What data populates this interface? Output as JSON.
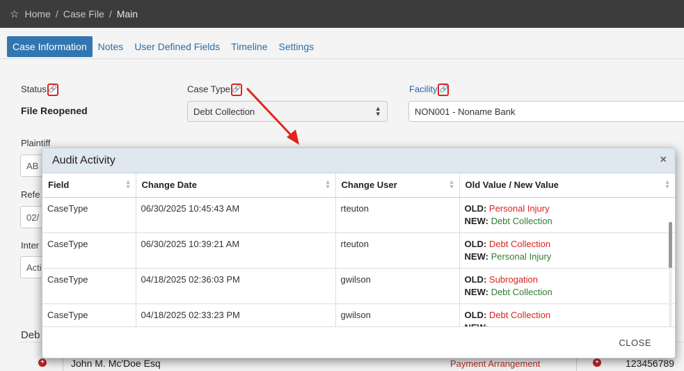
{
  "breadcrumb": {
    "items": [
      "Home",
      "Case File",
      "Main"
    ],
    "separator": "/"
  },
  "tabs": [
    "Case Information",
    "Notes",
    "User Defined Fields",
    "Timeline",
    "Settings"
  ],
  "form": {
    "status_label": "Status",
    "status_value": "File Reopened",
    "case_type_label": "Case Type",
    "case_type_value": "Debt Collection",
    "facility_label": "Facility",
    "facility_value": "NON001 - Noname Bank",
    "plaintiff_label": "Plaintiff",
    "plaintiff_value_partial": "AB",
    "reference_label_partial": "Refe",
    "reference_value_partial": "02/",
    "inter_label_partial": "Inter",
    "inter_value_partial": "Acti",
    "debtor_label_partial": "Deb"
  },
  "bottom_row": {
    "name": "John M. Mc'Doe Esq",
    "status": "Payment Arrangement",
    "number": "123456789"
  },
  "modal": {
    "title": "Audit Activity",
    "columns": [
      "Field",
      "Change Date",
      "Change User",
      "Old Value / New Value"
    ],
    "old_label": "OLD:",
    "new_label": "NEW:",
    "rows": [
      {
        "field": "CaseType",
        "date": "06/30/2025 10:45:43 AM",
        "user": "rteuton",
        "old": "Personal Injury",
        "new": "Debt Collection"
      },
      {
        "field": "CaseType",
        "date": "06/30/2025 10:39:21 AM",
        "user": "rteuton",
        "old": "Debt Collection",
        "new": "Personal Injury"
      },
      {
        "field": "CaseType",
        "date": "04/18/2025 02:36:03 PM",
        "user": "gwilson",
        "old": "Subrogation",
        "new": "Debt Collection"
      },
      {
        "field": "CaseType",
        "date": "04/18/2025 02:33:23 PM",
        "user": "gwilson",
        "old": "Debt Collection",
        "new": ""
      }
    ],
    "close_label": "CLOSE"
  },
  "colors": {
    "accent": "#3276b1",
    "highlight_red": "#d9231c",
    "old_value": "#d9231c",
    "new_value": "#2e7d32"
  },
  "icons": {
    "home": "star-icon",
    "link": "link-icon",
    "close": "close-icon",
    "sort": "sort-icon",
    "select_caret": "chevron-up-down-icon",
    "add": "plus-circle-icon"
  }
}
